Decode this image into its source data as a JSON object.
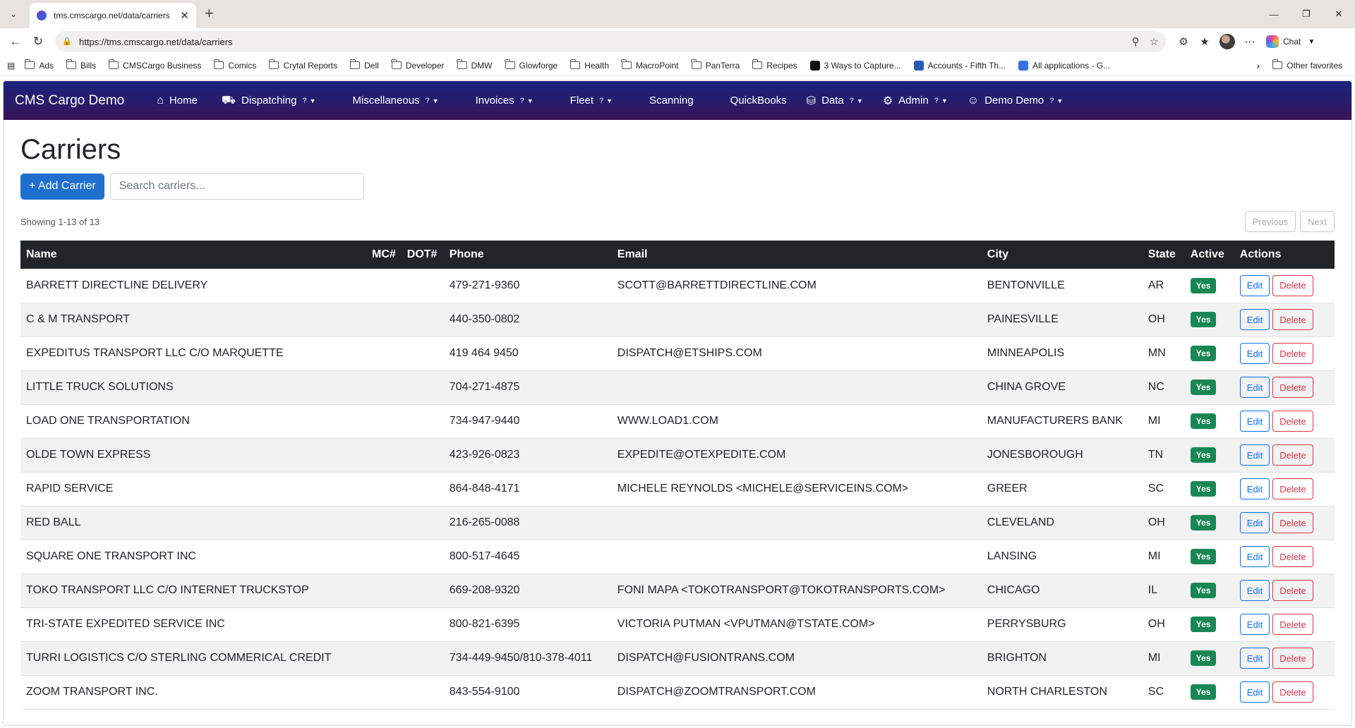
{
  "browser": {
    "tab_title": "tms.cmscargo.net/data/carriers",
    "url": "https://tms.cmscargo.net/data/carriers",
    "chat_label": "Chat",
    "bookmarks": [
      {
        "label": "Ads",
        "type": "folder"
      },
      {
        "label": "Bills",
        "type": "folder"
      },
      {
        "label": "CMSCargo Business",
        "type": "folder"
      },
      {
        "label": "Comics",
        "type": "folder"
      },
      {
        "label": "Crytal Reports",
        "type": "folder"
      },
      {
        "label": "Dell",
        "type": "folder"
      },
      {
        "label": "Developer",
        "type": "folder"
      },
      {
        "label": "DMW",
        "type": "folder"
      },
      {
        "label": "Glowforge",
        "type": "folder"
      },
      {
        "label": "Health",
        "type": "folder"
      },
      {
        "label": "MacroPoint",
        "type": "folder"
      },
      {
        "label": "PanTerra",
        "type": "folder"
      },
      {
        "label": "Recipes",
        "type": "folder"
      },
      {
        "label": "3 Ways to Capture...",
        "type": "site"
      },
      {
        "label": "Accounts - Fifth Th...",
        "type": "site"
      },
      {
        "label": "All applications - G...",
        "type": "site"
      }
    ],
    "other_favorites": "Other favorites"
  },
  "navbar": {
    "brand": "CMS Cargo Demo",
    "items": [
      {
        "label": "Home",
        "icon": "home-icon",
        "has_dropdown": false
      },
      {
        "label": "Dispatching",
        "icon": "truck-icon",
        "has_dropdown": true
      },
      {
        "label": "Miscellaneous",
        "icon": "",
        "has_dropdown": true
      },
      {
        "label": "Invoices",
        "icon": "",
        "has_dropdown": true
      },
      {
        "label": "Fleet",
        "icon": "",
        "has_dropdown": true
      },
      {
        "label": "Scanning",
        "icon": "",
        "has_dropdown": false
      },
      {
        "label": "QuickBooks",
        "icon": "",
        "has_dropdown": false
      },
      {
        "label": "Data",
        "icon": "database-icon",
        "has_dropdown": true
      },
      {
        "label": "Admin",
        "icon": "gear-icon",
        "has_dropdown": true
      },
      {
        "label": "Demo Demo",
        "icon": "user-icon",
        "has_dropdown": true
      }
    ],
    "help_mark": "?"
  },
  "page": {
    "title": "Carriers",
    "add_button": "+ Add Carrier",
    "search_placeholder": "Search carriers...",
    "showing": "Showing 1-13 of 13",
    "prev": "Previous",
    "next": "Next"
  },
  "table": {
    "columns": [
      "Name",
      "MC#",
      "DOT#",
      "Phone",
      "Email",
      "City",
      "State",
      "Active",
      "Actions"
    ],
    "edit_label": "Edit",
    "delete_label": "Delete",
    "rows": [
      {
        "name": "BARRETT DIRECTLINE DELIVERY",
        "mc": "",
        "dot": "",
        "phone": "479-271-9360",
        "email": "SCOTT@BARRETTDIRECTLINE.COM",
        "city": "BENTONVILLE",
        "state": "AR",
        "active": "Yes"
      },
      {
        "name": "C & M TRANSPORT",
        "mc": "",
        "dot": "",
        "phone": "440-350-0802",
        "email": "",
        "city": "PAINESVILLE",
        "state": "OH",
        "active": "Yes"
      },
      {
        "name": "EXPEDITUS TRANSPORT LLC C/O MARQUETTE",
        "mc": "",
        "dot": "",
        "phone": "419 464 9450",
        "email": "DISPATCH@ETSHIPS.COM",
        "city": "MINNEAPOLIS",
        "state": "MN",
        "active": "Yes"
      },
      {
        "name": "LITTLE TRUCK SOLUTIONS",
        "mc": "",
        "dot": "",
        "phone": "704-271-4875",
        "email": "",
        "city": "CHINA GROVE",
        "state": "NC",
        "active": "Yes"
      },
      {
        "name": "LOAD ONE TRANSPORTATION",
        "mc": "",
        "dot": "",
        "phone": "734-947-9440",
        "email": "WWW.LOAD1.COM",
        "city": "MANUFACTURERS BANK",
        "state": "MI",
        "active": "Yes"
      },
      {
        "name": "OLDE TOWN EXPRESS",
        "mc": "",
        "dot": "",
        "phone": "423-926-0823",
        "email": "EXPEDITE@OTEXPEDITE.COM",
        "city": "JONESBOROUGH",
        "state": "TN",
        "active": "Yes"
      },
      {
        "name": "RAPID SERVICE",
        "mc": "",
        "dot": "",
        "phone": "864-848-4171",
        "email": "MICHELE REYNOLDS <MICHELE@SERVICEINS.COM>",
        "city": "GREER",
        "state": "SC",
        "active": "Yes"
      },
      {
        "name": "RED BALL",
        "mc": "",
        "dot": "",
        "phone": "216-265-0088",
        "email": "",
        "city": "CLEVELAND",
        "state": "OH",
        "active": "Yes"
      },
      {
        "name": "SQUARE ONE TRANSPORT INC",
        "mc": "",
        "dot": "",
        "phone": "800-517-4645",
        "email": "",
        "city": "LANSING",
        "state": "MI",
        "active": "Yes"
      },
      {
        "name": "TOKO TRANSPORT LLC C/O INTERNET TRUCKSTOP",
        "mc": "",
        "dot": "",
        "phone": "669-208-9320",
        "email": "FONI MAPA <TOKOTRANSPORT@TOKOTRANSPORTS.COM>",
        "city": "CHICAGO",
        "state": "IL",
        "active": "Yes"
      },
      {
        "name": "TRI-STATE EXPEDITED SERVICE INC",
        "mc": "",
        "dot": "",
        "phone": "800-821-6395",
        "email": "VICTORIA PUTMAN <VPUTMAN@TSTATE.COM>",
        "city": "PERRYSBURG",
        "state": "OH",
        "active": "Yes"
      },
      {
        "name": "TURRI LOGISTICS C/O STERLING COMMERICAL CREDIT",
        "mc": "",
        "dot": "",
        "phone": "734-449-9450/810-378-4011",
        "email": "DISPATCH@FUSIONTRANS.COM",
        "city": "BRIGHTON",
        "state": "MI",
        "active": "Yes"
      },
      {
        "name": "ZOOM TRANSPORT INC.",
        "mc": "",
        "dot": "",
        "phone": "843-554-9100",
        "email": "DISPATCH@ZOOMTRANSPORT.COM",
        "city": "NORTH CHARLESTON",
        "state": "SC",
        "active": "Yes"
      }
    ]
  },
  "colors": {
    "navbar_start": "#1b237e",
    "navbar_end": "#3b1358",
    "primary": "#1f6fcf",
    "active_badge": "#198754",
    "danger": "#dc3545",
    "table_header": "#212529"
  }
}
